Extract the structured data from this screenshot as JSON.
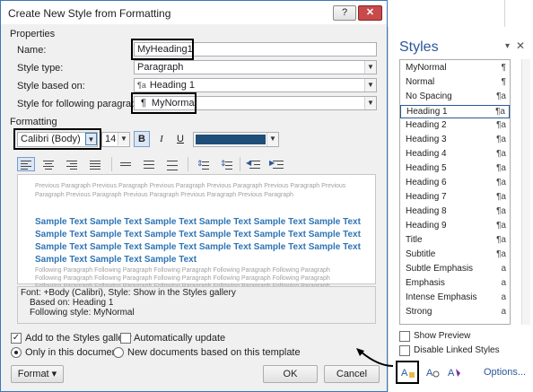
{
  "dialog": {
    "title": "Create New Style from Formatting",
    "help_glyph": "?",
    "close_glyph": "✕",
    "properties_label": "Properties",
    "name_label": "Name:",
    "name_value": "MyHeading1",
    "style_type_label": "Style type:",
    "style_type_value": "Paragraph",
    "based_on_label": "Style based on:",
    "based_on_glyph": "¶a",
    "based_on_value": "Heading 1",
    "following_label": "Style for following paragraph:",
    "following_glyph": "¶",
    "following_value": "MyNormal",
    "formatting_label": "Formatting",
    "font_value": "Calibri (Body)",
    "size_value": "14",
    "bold_label": "B",
    "italic_label": "I",
    "underline_label": "U",
    "font_color": "#1f4e79",
    "preview": {
      "previous_lines": [
        "Previous Paragraph Previous Paragraph Previous Paragraph Previous Paragraph Previous Paragraph Previous",
        "Paragraph Previous Paragraph Previous Paragraph Previous Paragraph Previous Paragraph"
      ],
      "sample_lines": [
        "Sample Text Sample Text Sample Text Sample Text Sample Text Sample Text",
        "Sample Text Sample Text Sample Text Sample Text Sample Text Sample Text",
        "Sample Text Sample Text Sample Text Sample Text Sample Text Sample Text",
        "Sample Text Sample Text Sample Text"
      ],
      "following_lines": [
        "Following Paragraph Following Paragraph Following Paragraph Following Paragraph Following Paragraph",
        "Following Paragraph Following Paragraph Following Paragraph Following Paragraph Following Paragraph",
        "Following Paragraph Following Paragraph Following Paragraph Following Paragraph Following Paragraph"
      ]
    },
    "description_lines": [
      "Font: +Body (Calibri), Style: Show in the Styles gallery",
      "Based on: Heading 1",
      "Following style: MyNormal"
    ],
    "add_to_gallery_label": "Add to the Styles gallery",
    "add_to_gallery_checked": true,
    "auto_update_label": "Automatically update",
    "auto_update_checked": false,
    "only_this_doc_label": "Only in this document",
    "new_docs_label": "New documents based on this template",
    "format_button": "Format ▾",
    "ok_button": "OK",
    "cancel_button": "Cancel"
  },
  "styles_pane": {
    "title": "Styles",
    "dropdown_glyph": "▾",
    "close_glyph": "✕",
    "items": [
      {
        "label": "MyNormal",
        "glyph": "¶"
      },
      {
        "label": "Normal",
        "glyph": "¶"
      },
      {
        "label": "No Spacing",
        "glyph": "¶a"
      },
      {
        "label": "Heading 1",
        "glyph": "¶a"
      },
      {
        "label": "Heading 2",
        "glyph": "¶a"
      },
      {
        "label": "Heading 3",
        "glyph": "¶a"
      },
      {
        "label": "Heading 4",
        "glyph": "¶a"
      },
      {
        "label": "Heading 5",
        "glyph": "¶a"
      },
      {
        "label": "Heading 6",
        "glyph": "¶a"
      },
      {
        "label": "Heading 7",
        "glyph": "¶a"
      },
      {
        "label": "Heading 8",
        "glyph": "¶a"
      },
      {
        "label": "Heading 9",
        "glyph": "¶a"
      },
      {
        "label": "Title",
        "glyph": "¶a"
      },
      {
        "label": "Subtitle",
        "glyph": "¶a"
      },
      {
        "label": "Subtle Emphasis",
        "glyph": "a"
      },
      {
        "label": "Emphasis",
        "glyph": "a"
      },
      {
        "label": "Intense Emphasis",
        "glyph": "a"
      },
      {
        "label": "Strong",
        "glyph": "a"
      }
    ],
    "show_preview_label": "Show Preview",
    "disable_linked_label": "Disable Linked Styles",
    "options_label": "Options...",
    "accent": "#2b579a"
  }
}
